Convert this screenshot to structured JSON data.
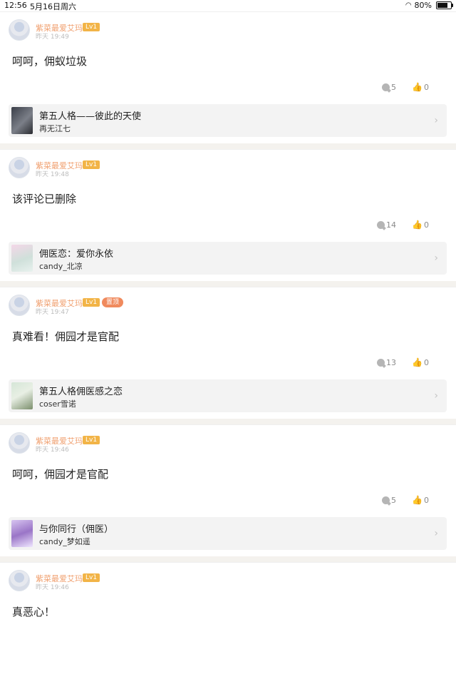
{
  "status_bar": {
    "time": "12:56",
    "date": "5月16日周六",
    "battery": "80%",
    "battery_level": 0.8
  },
  "posts": [
    {
      "username": "紫菜最爱艾玛",
      "level": "Lv1",
      "badge": "",
      "timestamp": "昨天 19:49",
      "content": "呵呵，佣蚁垃圾",
      "comments": "5",
      "likes": "0",
      "link": {
        "title": "第五人格——彼此的天使",
        "author": "再无江七"
      }
    },
    {
      "username": "紫菜最爱艾玛",
      "level": "Lv1",
      "badge": "",
      "timestamp": "昨天 19:48",
      "content": "该评论已删除",
      "comments": "14",
      "likes": "0",
      "link": {
        "title": "佣医恋：爱你永依",
        "author": "candy_北凉"
      }
    },
    {
      "username": "紫菜最爱艾玛",
      "level": "Lv1",
      "badge": "置顶",
      "timestamp": "昨天 19:47",
      "content": "真难看！佣园才是官配",
      "comments": "13",
      "likes": "0",
      "link": {
        "title": "第五人格佣医感之恋",
        "author": "coser雪诺"
      }
    },
    {
      "username": "紫菜最爱艾玛",
      "level": "Lv1",
      "badge": "",
      "timestamp": "昨天 19:46",
      "content": "呵呵，佣园才是官配",
      "comments": "5",
      "likes": "0",
      "link": {
        "title": "与你同行（佣医）",
        "author": "candy_梦如遥"
      }
    },
    {
      "username": "紫菜最爱艾玛",
      "level": "Lv1",
      "badge": "",
      "timestamp": "昨天 19:46",
      "content": "真恶心！"
    }
  ]
}
